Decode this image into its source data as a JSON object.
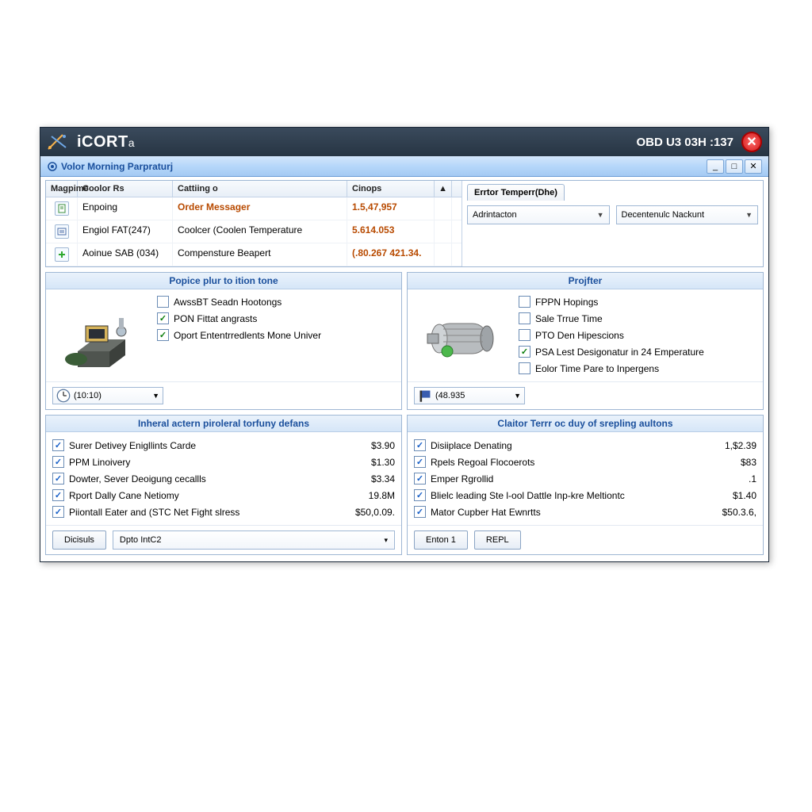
{
  "titlebar": {
    "brand_main": "iCORT",
    "brand_suffix": "a",
    "status": "OBD U3 03H :137"
  },
  "subtitle": "Volor Morning Parpraturj",
  "grid": {
    "headers": {
      "icon": "Magpime",
      "a": "Coolor Rs",
      "b": "Cattiing o",
      "c": "Cinops"
    },
    "rows": [
      {
        "a": "Enpoing",
        "b": "Order Messager",
        "b_highlight": true,
        "c": "1.5,47,957",
        "icon": "doc"
      },
      {
        "a": "Engiol FAT(247)",
        "b": "Coolcer (Coolen Temperature",
        "c": "5.614.053",
        "icon": "list"
      },
      {
        "a": "Aoinue SAB (034)",
        "b": "Compensture Beapert",
        "c": "(.80.267 421.34.",
        "icon": "plus"
      }
    ]
  },
  "right_pane": {
    "tab": "Errtor Temperr(Dhe)",
    "combo1": "Adrintacton",
    "combo2": "Decentenulc Nackunt"
  },
  "panel_left": {
    "title": "Popice plur to ition tone",
    "items": [
      {
        "label": "AwssBT Seadn Hootongs",
        "checked": false
      },
      {
        "label": "PON Fittat angrasts",
        "checked": true
      },
      {
        "label": "Oport Ententrredlents Mone Univer",
        "checked": true
      }
    ],
    "combo": "(10:10)"
  },
  "panel_right": {
    "title": "Projfter",
    "items": [
      {
        "label": "FPPN Hopings",
        "checked": false
      },
      {
        "label": "Sale Trrue Time",
        "checked": false
      },
      {
        "label": "PTO Den Hipescions",
        "checked": false
      },
      {
        "label": "PSA Lest Desigonatur in 24 Emperature",
        "checked": true
      },
      {
        "label": "Eolor Time Pare to Inpergens",
        "checked": false
      }
    ],
    "combo": "(48.935"
  },
  "list_left": {
    "title": "Inheral actern piroleral torfuny defans",
    "rows": [
      {
        "label": "Surer Detivey Enigllints Carde",
        "amount": "$3.90"
      },
      {
        "label": "PPM Linoivery",
        "amount": "$1.30"
      },
      {
        "label": "Dowter, Sever Deoigung cecallls",
        "amount": "$3.34"
      },
      {
        "label": "Rport Dally Cane Netiomy",
        "amount": "19.8M"
      },
      {
        "label": "Piiontall Eater and (STC Net Fight slress",
        "amount": "$50,0.09."
      }
    ],
    "btn": "Dicisuls",
    "combo": "Dpto IntC2"
  },
  "list_right": {
    "title": "Claitor Terrr oc duy of srepling aultons",
    "rows": [
      {
        "label": "Disiiplace Denating",
        "amount": "1,$2.39"
      },
      {
        "label": "Rpels Regoal Flocoerots",
        "amount": "$83"
      },
      {
        "label": "Emper Rgrollid",
        "amount": ".1"
      },
      {
        "label": "Blielc leading Ste l-ool Dattle Inp-kre Meltiontc",
        "amount": "$1.40"
      },
      {
        "label": "Mator Cupber Hat Ewnrtts",
        "amount": "$50.3.6,"
      }
    ],
    "btn1": "Enton 1",
    "btn2": "REPL"
  }
}
